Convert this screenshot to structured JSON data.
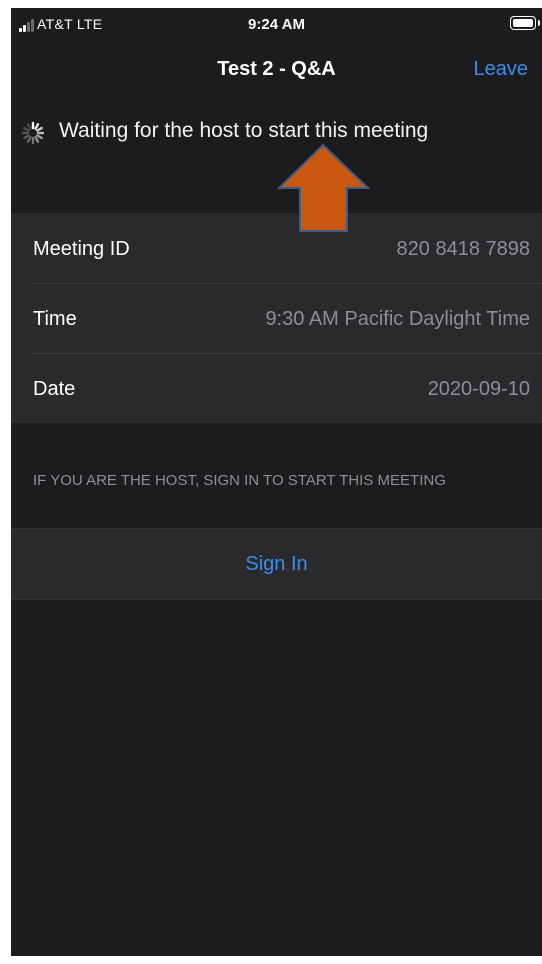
{
  "status_bar": {
    "carrier": "AT&T  LTE",
    "time": "9:24 AM"
  },
  "nav": {
    "title": "Test 2 - Q&A",
    "leave_label": "Leave"
  },
  "waiting_message": "Waiting for the host to start this meeting",
  "meeting_info": [
    {
      "label": "Meeting ID",
      "value": "820 8418 7898"
    },
    {
      "label": "Time",
      "value": "9:30 AM Pacific Daylight Time"
    },
    {
      "label": "Date",
      "value": "2020-09-10"
    }
  ],
  "host_note": "IF YOU ARE THE HOST, SIGN IN TO START THIS MEETING",
  "sign_in_label": "Sign In",
  "colors": {
    "background": "#1c1c1e",
    "panel": "#2a2a2c",
    "accent": "#3a8cf0",
    "annotation_arrow": "#c8580e"
  },
  "icons": {
    "signal": "cellular-signal-icon",
    "battery": "battery-icon",
    "spinner": "loading-spinner-icon",
    "annotation": "up-arrow-annotation-icon"
  }
}
